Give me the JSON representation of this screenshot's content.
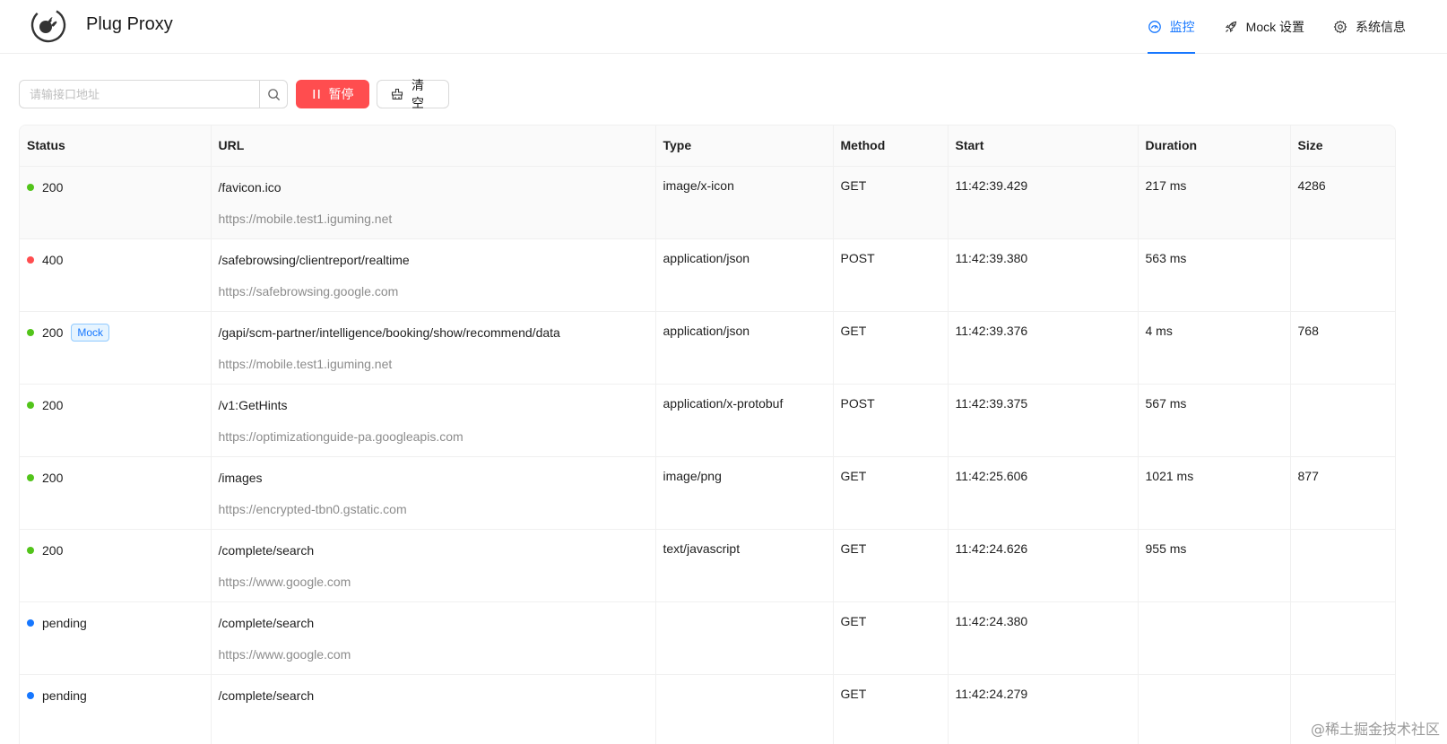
{
  "app": {
    "title": "Plug Proxy"
  },
  "nav": {
    "items": [
      {
        "label": "监控",
        "icon": "dashboard-icon",
        "active": true
      },
      {
        "label": "Mock 设置",
        "icon": "rocket-icon",
        "active": false
      },
      {
        "label": "系统信息",
        "icon": "gear-icon",
        "active": false
      }
    ]
  },
  "toolbar": {
    "search_placeholder": "请输接口地址",
    "pause_label": "暂停",
    "clear_label": "清空"
  },
  "table": {
    "columns": [
      "Status",
      "URL",
      "Type",
      "Method",
      "Start",
      "Duration",
      "Size"
    ],
    "rows": [
      {
        "status": "200",
        "status_color": "green",
        "mock": "",
        "path": "/favicon.ico",
        "host": "https://mobile.test1.iguming.net",
        "type": "image/x-icon",
        "method": "GET",
        "start": "11:42:39.429",
        "duration": "217 ms",
        "size": "4286"
      },
      {
        "status": "400",
        "status_color": "red",
        "mock": "",
        "path": "/safebrowsing/clientreport/realtime",
        "host": "https://safebrowsing.google.com",
        "type": "application/json",
        "method": "POST",
        "start": "11:42:39.380",
        "duration": "563 ms",
        "size": ""
      },
      {
        "status": "200",
        "status_color": "green",
        "mock": "Mock",
        "path": "/gapi/scm-partner/intelligence/booking/show/recommend/data",
        "host": "https://mobile.test1.iguming.net",
        "type": "application/json",
        "method": "GET",
        "start": "11:42:39.376",
        "duration": "4 ms",
        "size": "768"
      },
      {
        "status": "200",
        "status_color": "green",
        "mock": "",
        "path": "/v1:GetHints",
        "host": "https://optimizationguide-pa.googleapis.com",
        "type": "application/x-protobuf",
        "method": "POST",
        "start": "11:42:39.375",
        "duration": "567 ms",
        "size": ""
      },
      {
        "status": "200",
        "status_color": "green",
        "mock": "",
        "path": "/images",
        "host": "https://encrypted-tbn0.gstatic.com",
        "type": "image/png",
        "method": "GET",
        "start": "11:42:25.606",
        "duration": "1021 ms",
        "size": "877"
      },
      {
        "status": "200",
        "status_color": "green",
        "mock": "",
        "path": "/complete/search",
        "host": "https://www.google.com",
        "type": "text/javascript",
        "method": "GET",
        "start": "11:42:24.626",
        "duration": "955 ms",
        "size": ""
      },
      {
        "status": "pending",
        "status_color": "blue",
        "mock": "",
        "path": "/complete/search",
        "host": "https://www.google.com",
        "type": "",
        "method": "GET",
        "start": "11:42:24.380",
        "duration": "",
        "size": ""
      },
      {
        "status": "pending",
        "status_color": "blue",
        "mock": "",
        "path": "/complete/search",
        "host": "",
        "type": "",
        "method": "GET",
        "start": "11:42:24.279",
        "duration": "",
        "size": ""
      }
    ]
  },
  "watermark": "@稀土掘金技术社区",
  "colors": {
    "accent": "#1677ff",
    "danger": "#ff4d4f",
    "success": "#52c41a"
  }
}
